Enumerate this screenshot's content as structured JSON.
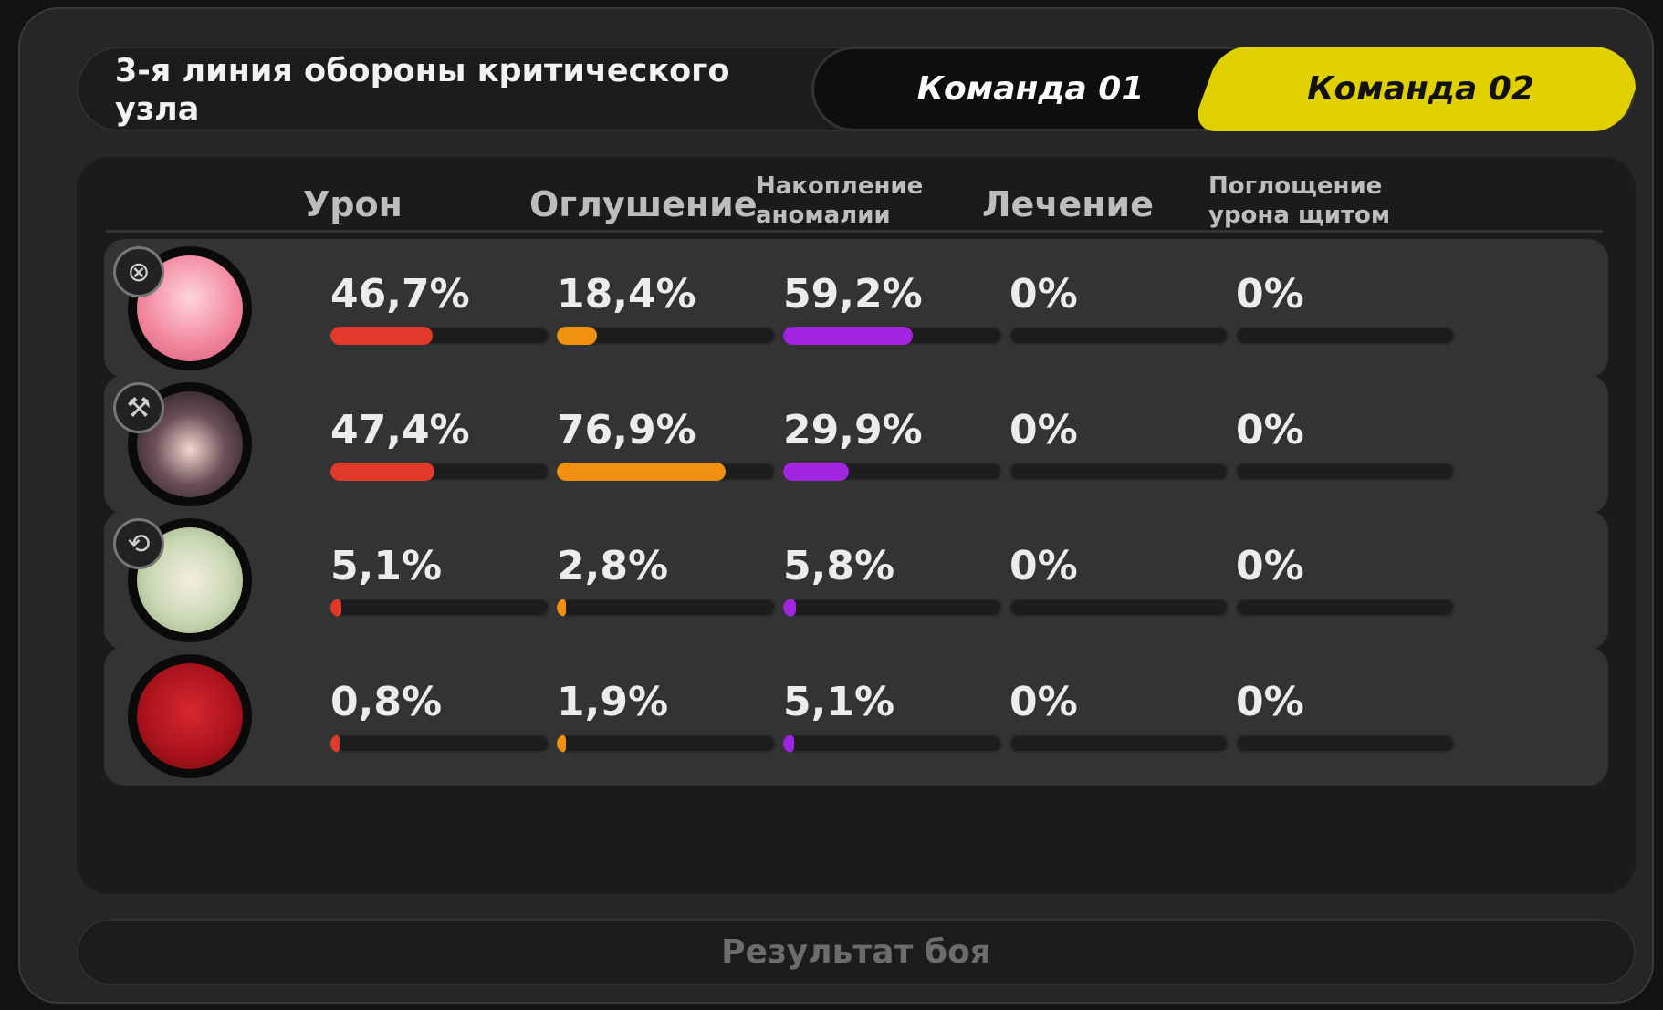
{
  "header": {
    "title": "3-я линия обороны критического узла",
    "tabs": [
      {
        "label": "Команда 01",
        "active": false
      },
      {
        "label": "Команда 02",
        "active": true
      }
    ]
  },
  "columns": [
    "Урон",
    "Оглушение",
    "Накопление аномалии",
    "Лечение",
    "Поглощение урона щитом"
  ],
  "colors": {
    "damage": "#e23a2a",
    "daze": "#f0900f",
    "anomaly": "#a024e0",
    "active_tab": "#e0d000"
  },
  "rows": [
    {
      "avatar": "agent-1-avatar",
      "badge": "attack-specialty-icon",
      "stats": [
        "46,7%",
        "18,4%",
        "59,2%",
        "0%",
        "0%"
      ],
      "fractions": [
        0.467,
        0.184,
        0.592,
        0,
        0
      ]
    },
    {
      "avatar": "agent-2-avatar",
      "badge": "stun-specialty-icon",
      "stats": [
        "47,4%",
        "76,9%",
        "29,9%",
        "0%",
        "0%"
      ],
      "fractions": [
        0.474,
        0.769,
        0.299,
        0,
        0
      ]
    },
    {
      "avatar": "agent-3-avatar",
      "badge": "support-specialty-icon",
      "stats": [
        "5,1%",
        "2,8%",
        "5,8%",
        "0%",
        "0%"
      ],
      "fractions": [
        0.051,
        0.028,
        0.058,
        0,
        0
      ]
    },
    {
      "avatar": "bangboo-avatar",
      "badge": "",
      "stats": [
        "0,8%",
        "1,9%",
        "5,1%",
        "0%",
        "0%"
      ],
      "fractions": [
        0.008,
        0.019,
        0.051,
        0,
        0
      ]
    }
  ],
  "footer": {
    "result_label": "Результат боя"
  }
}
